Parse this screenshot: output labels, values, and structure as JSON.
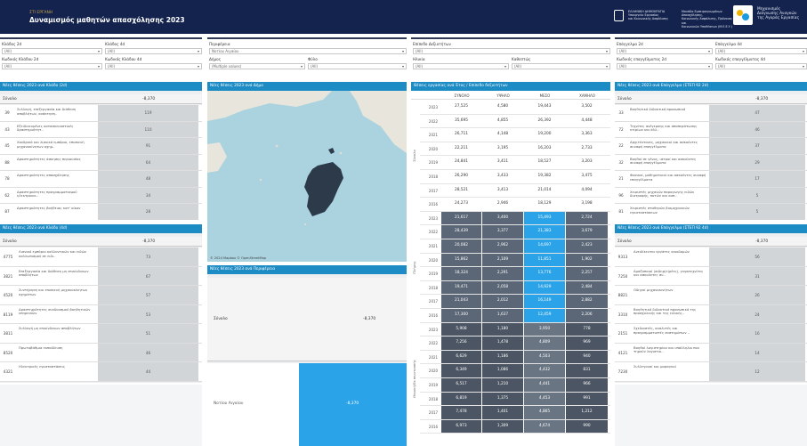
{
  "header": {
    "subtitle": "ΣΤΙ ΕΡΓΑΝΗ",
    "title": "Δυναμισμός μαθητών απασχόλησης 2023",
    "ministry_lines": [
      "ΕΛΛΗΝΙΚΗ ΔΗΜΟΚΡΑΤΙΑ",
      "Υπουργείο Εργασίας",
      "και Κοινωνικής Ασφάλισης"
    ],
    "agency_lines": [
      "Μονάδα Εμπειρογνωμόνων Απασχόλησης,",
      "Κοινωνικής Ασφάλισης, Πρόνοιας και",
      "Κοινωνικών Υποθέσεων (Μ.Ε.Ε.Υ.)"
    ],
    "brand_lines": [
      "Μηχανισμός",
      "Διάγνωσης Αναγκών",
      "της Αγοράς Εργασίας"
    ]
  },
  "filters": [
    {
      "label": "Κλάδος 2d",
      "value": "(All)"
    },
    {
      "label": "Κλάδος 4d",
      "value": "(All)"
    },
    {
      "label": "Κωδικός Κλάδου 2d",
      "value": "(All)"
    },
    {
      "label": "Κωδικός Κλάδου 4d",
      "value": "(All)"
    },
    {
      "label": "Περιφέρεια",
      "value": "Νοτίου Αιγαίου"
    },
    {
      "label": "Δήμος",
      "value": "(Multiple values)"
    },
    {
      "label": "Φύλο",
      "value": "(All)"
    },
    {
      "label": "Επίπεδο Δεξιοτήτων",
      "value": "(All)"
    },
    {
      "label": "Ηλικία",
      "value": "(All)"
    },
    {
      "label": "Καθεστώς",
      "value": "(All)"
    },
    {
      "label": "Επάγγελμα 2d",
      "value": "(All)"
    },
    {
      "label": "Επάγγελμα 4d",
      "value": "(All)"
    },
    {
      "label": "Κωδικός επαγγέλματος 2d",
      "value": "(All)"
    },
    {
      "label": "Κωδικός επαγγέλματος 4d",
      "value": "(All)"
    }
  ],
  "sector2": {
    "title": "Νέες θέσεις 2023 ανά Κλάδο (2d)",
    "total_label": "Σύνολο",
    "total_value": "-8,370",
    "rows": [
      {
        "code": "39",
        "desc": "Συλλογή, επεξεργασία και διάθεση αποβλήτων, ανάκτηση..",
        "val": "119"
      },
      {
        "code": "43",
        "desc": "Εξειδικευμένες κατασκευαστικές δραστηριότητ..",
        "val": "110"
      },
      {
        "code": "45",
        "desc": "Χονδρικό και λιανικό εμπόριο, επισκευή μηχανοκίνητων οχημ..",
        "val": "91"
      },
      {
        "code": "88",
        "desc": "Δραστηριότητες άσκησης περιουσίας",
        "val": "64"
      },
      {
        "code": "78",
        "desc": "Δραστηριότητες απασχόλησης",
        "val": "48"
      },
      {
        "code": "62",
        "desc": "Δραστηριότητες προγραμματισμού ηλεκτρονικ..",
        "val": "34"
      },
      {
        "code": "87",
        "desc": "Δραστηριότητες βοήθειας κατ' οίκον",
        "val": "28"
      }
    ]
  },
  "sector4": {
    "title": "Νέες θέσεις 2023 ανά Κλάδο (4d)",
    "total_label": "Σύνολο",
    "total_value": "-8,370",
    "rows": [
      {
        "code": "4775",
        "desc": "Λιανικό εμπόριο καλλυντικών και ειδών καλλωπισμού σε ειδι..",
        "val": "73"
      },
      {
        "code": "3821",
        "desc": "Επεξεργασία και διάθεση μη επικίνδυνων αποβλήτων",
        "val": "67"
      },
      {
        "code": "4520",
        "desc": "Συντήρηση και επισκευή μηχανοκίνητων οχημάτων",
        "val": "57"
      },
      {
        "code": "8119",
        "desc": "Δραστηριότητες συνδυασμού βοηθητικών υπηρεσιών",
        "val": "53"
      },
      {
        "code": "3811",
        "desc": "Συλλογή μη επικίνδυνων αποβλήτων",
        "val": "51"
      },
      {
        "code": "8520",
        "desc": "Πρωτοβάθμια εκπαίδευση",
        "val": "46"
      },
      {
        "code": "4321",
        "desc": "Ηλεκτρικές εγκαταστάσεις",
        "val": "44"
      }
    ]
  },
  "map": {
    "title": "Νέες θέσεις 2023 ανά Δήμο",
    "attribution": "© 2024 Mapbox  © OpenStreetMap"
  },
  "region": {
    "title": "Νέες θέσεις 2023 ανά Περιφέρεια",
    "total_label": "Σύνολο",
    "total_value": "-8,370",
    "rows": [
      {
        "name": "Νοτίου Αιγαίου",
        "val": "-8,370"
      }
    ]
  },
  "skills": {
    "title": "Θέσεις εργασίας ανά Έτος / Επίπεδο δεξιοτήτων",
    "columns": [
      "ΣΥΝΟΛΟ",
      "ΥΨΗΛΟ",
      "ΜΕΣΟ",
      "ΧΑΜΗΛΟ"
    ],
    "groups": [
      {
        "label": "Σύνολο",
        "rows": [
          [
            "2023",
            "27,525",
            "4,580",
            "19,443",
            "3,502"
          ],
          [
            "2022",
            "35,695",
            "4,855",
            "26,392",
            "4,448"
          ],
          [
            "2021",
            "26,711",
            "4,148",
            "19,200",
            "3,363"
          ],
          [
            "2020",
            "22,211",
            "3,195",
            "16,203",
            "2,733"
          ],
          [
            "2019",
            "24,841",
            "3,411",
            "18,527",
            "3,203"
          ],
          [
            "2018",
            "26,290",
            "3,433",
            "19,382",
            "3,475"
          ],
          [
            "2017",
            "28,521",
            "3,413",
            "21,014",
            "4,094"
          ],
          [
            "2016",
            "24,273",
            "2,946",
            "18,129",
            "3,198"
          ]
        ]
      },
      {
        "label": "Πλήρης",
        "rows": [
          [
            "2023",
            "21,617",
            "3,400",
            "15,493",
            "2,724"
          ],
          [
            "2022",
            "28,439",
            "3,377",
            "21,383",
            "3,679"
          ],
          [
            "2021",
            "20,082",
            "2,962",
            "14,697",
            "2,423"
          ],
          [
            "2020",
            "15,862",
            "2,109",
            "11,851",
            "1,902"
          ],
          [
            "2019",
            "18,324",
            "2,291",
            "13,776",
            "2,257"
          ],
          [
            "2018",
            "19,471",
            "2,058",
            "14,929",
            "2,484"
          ],
          [
            "2017",
            "21,043",
            "2,012",
            "16,149",
            "2,882"
          ],
          [
            "2016",
            "17,300",
            "1,637",
            "12,459",
            "2,206"
          ]
        ]
      },
      {
        "label": "Μερική/Εκ περιτροπής",
        "rows": [
          [
            "2023",
            "5,908",
            "1,180",
            "3,950",
            "778"
          ],
          [
            "2022",
            "7,256",
            "1,478",
            "4,809",
            "969"
          ],
          [
            "2021",
            "6,629",
            "1,186",
            "4,503",
            "940"
          ],
          [
            "2020",
            "6,349",
            "1,086",
            "4,432",
            "831"
          ],
          [
            "2019",
            "6,517",
            "1,210",
            "4,441",
            "966"
          ],
          [
            "2018",
            "6,819",
            "1,375",
            "4,453",
            "991"
          ],
          [
            "2017",
            "7,478",
            "1,401",
            "4,865",
            "1,212"
          ],
          [
            "2016",
            "6,973",
            "1,309",
            "4,674",
            "990"
          ]
        ]
      }
    ]
  },
  "occ2": {
    "title": "Νέες θέσεις 2023 ανά Επάγγελμα (ΣΤΕΠ 92 2d)",
    "total_label": "Σύνολο",
    "total_value": "-8,370",
    "rows": [
      {
        "code": "33",
        "desc": "Βοηθητικό διδακτικό προσωπικό",
        "val": "47"
      },
      {
        "code": "72",
        "desc": "Τεχνίτες ανέγερσης και αποπεράτωσης κτιρίων και άλλ..",
        "val": "46"
      },
      {
        "code": "22",
        "desc": "Αρχιτέκτονες, μηχανικοί και ασκούντες συναφή επαγγέλματα",
        "val": "37"
      },
      {
        "code": "32",
        "desc": "Βοηθοί σε γένος, ιατροί και ασκούντες συναφή επαγγέλματα",
        "val": "29"
      },
      {
        "code": "21",
        "desc": "Φυσικοί, μαθηματικοί και ασκούντες συναφή επαγγέλματα",
        "val": "17"
      },
      {
        "code": "96",
        "desc": "Χειριστές μηχανών παραγωγής ειδών διατροφής, ποτών και καπ..",
        "val": "5"
      },
      {
        "code": "81",
        "desc": "Χειριστές σταθερών βιομηχανικών εγκαταστάσεων",
        "val": "5"
      }
    ]
  },
  "occ4": {
    "title": "Νέες θέσεις 2023 ανά Επάγγελμα (ΣΤΕΠ 92 4d)",
    "total_label": "Σύνολο",
    "total_value": "-8,370",
    "rows": [
      {
        "code": "9313",
        "desc": "Ανειδίκευτοι εργάτες οικοδομών",
        "val": "56"
      },
      {
        "code": "7250",
        "desc": "Αμαξοποιοί (σιδηρ(ε)ρέες), γυψοτεχνίτες και ασκούντες συ..",
        "val": "31"
      },
      {
        "code": "8821",
        "desc": "Οδηγοί μηχανοκινήτων",
        "val": "26"
      },
      {
        "code": "3310",
        "desc": "Βοηθητικό διδακτικό προσωπικό της προσχολικής και της ειδικής..",
        "val": "24"
      },
      {
        "code": "2151",
        "desc": "Σχεδιαστές, αναλυτές και προγραμματιστές συστημάτων ..",
        "val": "16"
      },
      {
        "code": "4121",
        "desc": "Βοηθοί λογιστηρίου και υπάλληλοι που τηρούν λογιστικ..",
        "val": "14"
      },
      {
        "code": "7230",
        "desc": "Συλλεγουοί και μαραγκοί",
        "val": "12"
      }
    ]
  }
}
